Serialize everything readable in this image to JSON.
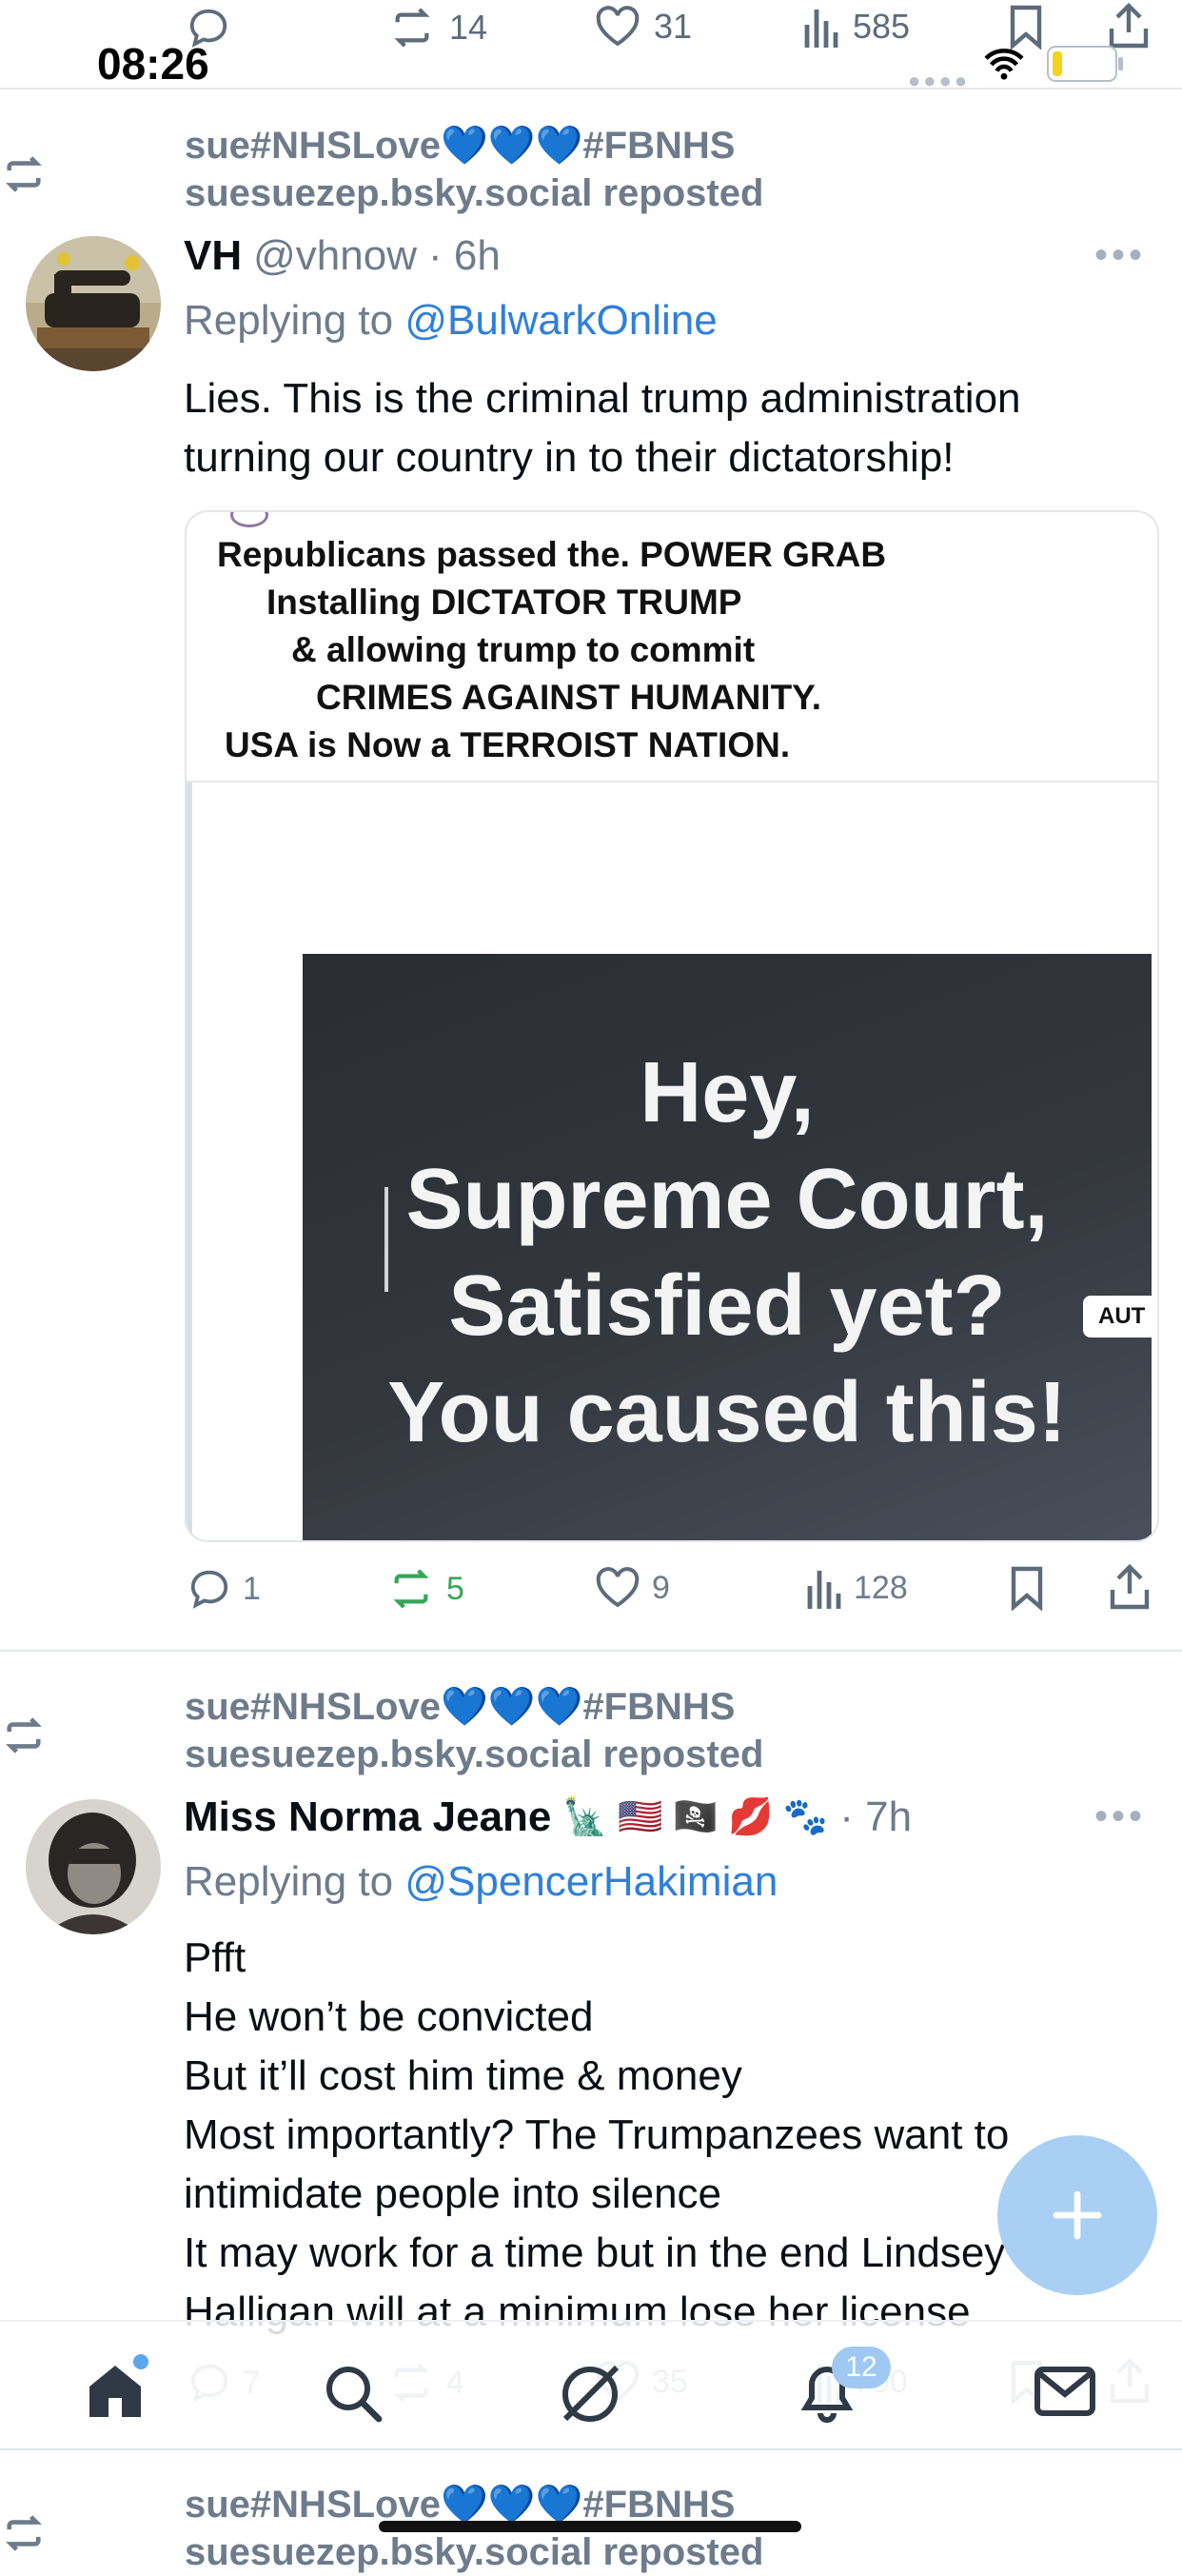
{
  "status": {
    "time": "08:26",
    "top_counts": {
      "reply": "",
      "repost": "14",
      "like": "31",
      "views": "585"
    }
  },
  "posts": [
    {
      "repost_user": "sue#NHSLove",
      "repost_tag": "#FBNHS",
      "repost_line2": "suesuezep.bsky.social reposted",
      "name": "VH",
      "handle": "@vhnow",
      "time": "· 6h",
      "reply_prefix": "Replying to ",
      "reply_to": "@BulwarkOnline",
      "text_lines": [
        "Lies.  This is the criminal trump administration",
        "turning our country in to their dictatorship!"
      ],
      "media": {
        "caption_lines": [
          "Republicans passed the. POWER GRAB",
          "Installing DICTATOR TRUMP",
          "& allowing trump to commit",
          "CRIMES AGAINST HUMANITY.",
          "USA is Now a TERROIST NATION."
        ],
        "image_lines": [
          "Hey,",
          "Supreme Court,",
          "Satisfied yet?",
          "You caused this!"
        ],
        "edge_label": "AUT"
      },
      "counts": {
        "reply": "1",
        "repost": "5",
        "like": "9",
        "views": "128"
      }
    },
    {
      "repost_user": "sue#NHSLove",
      "repost_tag": "#FBNHS",
      "repost_line2": "suesuezep.bsky.social reposted",
      "name": "Miss Norma Jeane",
      "name_emojis": "🗽 🇺🇸 🏴‍☠️ 💋 🐾",
      "time": "· 7h",
      "reply_prefix": "Replying to ",
      "reply_to": "@SpencerHakimian",
      "text_lines": [
        "Pfft",
        "He won’t be convicted",
        "But it’ll cost him time & money",
        "Most importantly? The Trumpanzees want to",
        "intimidate people into silence",
        "It may work for a time but in the end Lindsey",
        "Halligan will at a minimum lose her license"
      ],
      "counts": {
        "reply": "7",
        "repost": "4",
        "like": "35",
        "views": "700"
      }
    },
    {
      "repost_user": "sue#NHSLove",
      "repost_tag": "#FBNHS",
      "repost_line2": "suesuezep.bsky.social reposted"
    }
  ],
  "tabbar": {
    "notifications_badge": "12"
  },
  "colors": {
    "accent": "#2f7fdb",
    "repost_green": "#36a657",
    "heart_blue": "#1f5ee8",
    "fab": "#a9d0f4"
  }
}
